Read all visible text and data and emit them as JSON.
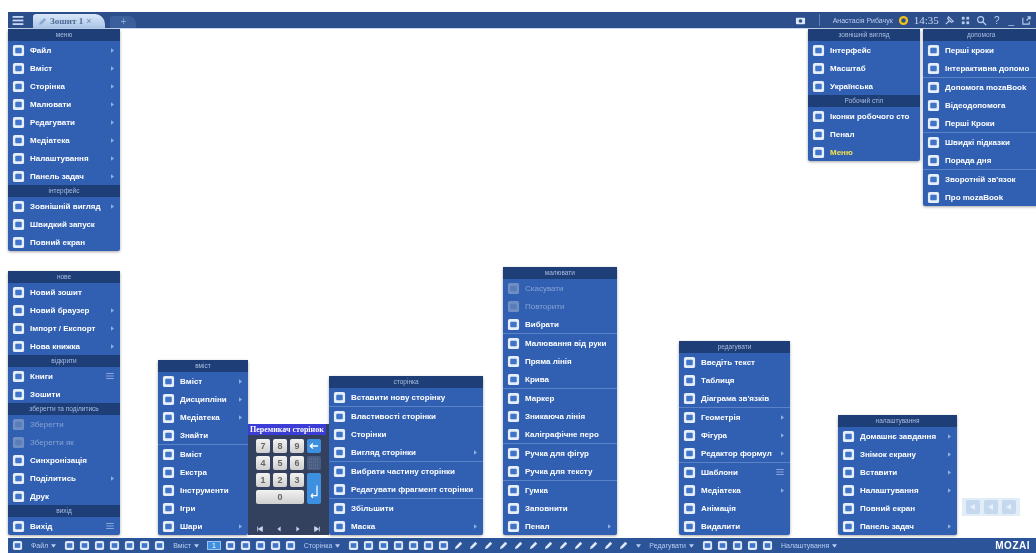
{
  "top_bar": {
    "tabs": [
      {
        "label": "Зошит 1",
        "close": "×",
        "selected": true
      }
    ],
    "add_tab": "+",
    "user": "Анастасія Рибачук",
    "time": "14:35",
    "help": "?",
    "minimize": "_"
  },
  "menus": [
    {
      "sections": [
        {
          "header": "меню",
          "groups": [
            [
              {
                "label": "Файл",
                "submenu": true
              },
              {
                "label": "Вміст",
                "submenu": true
              },
              {
                "label": "Сторінка",
                "submenu": true
              },
              {
                "label": "Малювати",
                "submenu": true
              },
              {
                "label": "Редагувати",
                "submenu": true
              },
              {
                "label": "Медіатека",
                "submenu": true
              },
              {
                "label": "Налаштування",
                "submenu": true
              },
              {
                "label": "Панель задач",
                "submenu": true
              }
            ]
          ]
        },
        {
          "header": "інтерфейс",
          "groups": [
            [
              {
                "label": "Зовнішній вигляд",
                "submenu": true
              },
              {
                "label": "Швидкий запуск",
                "submenu": false
              },
              {
                "label": "Повний екран",
                "submenu": false
              }
            ]
          ]
        }
      ]
    },
    {
      "sections": [
        {
          "header": "зовнішній вигляд",
          "groups": [
            [
              {
                "label": "Інтерфейс",
                "selected": false
              },
              {
                "label": "Масштаб",
                "selected": false
              },
              {
                "label": "Українська",
                "selected": false
              }
            ]
          ]
        },
        {
          "header": "Робочий стіл",
          "groups": [
            [
              {
                "label": "Іконки робочого сто",
                "selected": false
              },
              {
                "label": "Пенал",
                "selected": false
              },
              {
                "label": "Меню",
                "selected": true
              }
            ]
          ]
        }
      ]
    },
    {
      "sections": [
        {
          "header": "допомога",
          "groups": [
            [
              {
                "label": "Перші кроки"
              },
              {
                "label": "Інтерактивна допомо"
              }
            ],
            [
              {
                "label": "Допомога mozaBook"
              },
              {
                "label": "Відеодопомога"
              },
              {
                "label": "Перші Кроки"
              }
            ],
            [
              {
                "label": "Швидкі підказки"
              },
              {
                "label": "Порада дня"
              }
            ],
            [
              {
                "label": "Зворотній зв'язок"
              },
              {
                "label": "Про mozaBook"
              }
            ]
          ]
        }
      ]
    },
    {
      "sections": [
        {
          "header": "нове",
          "groups": [
            [
              {
                "label": "Новий зошит",
                "submenu": false,
                "list": false,
                "disabled": false
              },
              {
                "label": "Новий браузер",
                "submenu": true,
                "list": false,
                "disabled": false
              },
              {
                "label": "Імпорт / Експорт",
                "submenu": true,
                "list": false,
                "disabled": false
              },
              {
                "label": "Нова книжка",
                "submenu": true,
                "list": false,
                "disabled": false
              }
            ]
          ]
        },
        {
          "header": "відкрити",
          "groups": [
            [
              {
                "label": "Книги",
                "submenu": false,
                "list": true,
                "disabled": false
              },
              {
                "label": "Зошити",
                "submenu": false,
                "list": false,
                "disabled": false
              }
            ]
          ]
        },
        {
          "header": "зберегти та поділитись",
          "groups": [
            [
              {
                "label": "Зберегти",
                "submenu": false,
                "list": false,
                "disabled": true
              },
              {
                "label": "Зберегти як",
                "submenu": false,
                "list": false,
                "disabled": true
              },
              {
                "label": "Синхронізація",
                "submenu": false,
                "list": false,
                "disabled": false
              },
              {
                "label": "Поділитись",
                "submenu": true,
                "list": false,
                "disabled": false
              },
              {
                "label": "Друк",
                "submenu": false,
                "list": false,
                "disabled": false
              }
            ]
          ]
        },
        {
          "header": "вихід",
          "groups": [
            [
              {
                "label": "Вихід",
                "submenu": false,
                "list": true,
                "disabled": false
              }
            ]
          ]
        }
      ]
    },
    {
      "sections": [
        {
          "header": "вміст",
          "groups": [
            [
              {
                "label": "Вміст",
                "submenu": true
              },
              {
                "label": "Дисципліни",
                "submenu": true
              },
              {
                "label": "Медіатека",
                "submenu": true
              },
              {
                "label": "Знайти",
                "submenu": false
              }
            ],
            [
              {
                "label": "Вміст",
                "submenu": false
              },
              {
                "label": "Екстра",
                "submenu": false
              },
              {
                "label": "Інструменти",
                "submenu": false
              },
              {
                "label": "Ігри",
                "submenu": false
              },
              {
                "label": "Шари",
                "submenu": true
              }
            ]
          ]
        }
      ]
    },
    {
      "sections": [
        {
          "header": "сторінка",
          "groups": [
            [
              {
                "label": "Вставити нову сторінку",
                "submenu": false
              }
            ],
            [
              {
                "label": "Властивості сторінки",
                "submenu": false
              },
              {
                "label": "Сторінки",
                "submenu": false
              },
              {
                "label": "Вигляд сторінки",
                "submenu": true
              }
            ],
            [
              {
                "label": "Вибрати частину сторінки",
                "submenu": false
              },
              {
                "label": "Редагувати фрагмент сторінки",
                "submenu": false
              }
            ],
            [
              {
                "label": "Збільшити",
                "submenu": false
              },
              {
                "label": "Маска",
                "submenu": true
              }
            ]
          ]
        }
      ]
    },
    {
      "sections": [
        {
          "header": "малювати",
          "groups": [
            [
              {
                "label": "Скасувати",
                "submenu": false,
                "disabled": true
              },
              {
                "label": "Повторити",
                "submenu": false,
                "disabled": true
              },
              {
                "label": "Вибрати",
                "submenu": false,
                "disabled": false
              }
            ],
            [
              {
                "label": "Малювання від руки",
                "submenu": false,
                "disabled": false
              },
              {
                "label": "Пряма лінія",
                "submenu": false,
                "disabled": false
              },
              {
                "label": "Крива",
                "submenu": false,
                "disabled": false
              }
            ],
            [
              {
                "label": "Маркер",
                "submenu": false,
                "disabled": false
              },
              {
                "label": "Зникаюча лінія",
                "submenu": false,
                "disabled": false
              },
              {
                "label": "Каліграфічне перо",
                "submenu": false,
                "disabled": false
              }
            ],
            [
              {
                "label": "Ручка для фігур",
                "submenu": false,
                "disabled": false
              },
              {
                "label": "Ручка для тексту",
                "submenu": false,
                "disabled": false
              }
            ],
            [
              {
                "label": "Гумка",
                "submenu": false,
                "disabled": false
              },
              {
                "label": "Заповнити",
                "submenu": false,
                "disabled": false
              },
              {
                "label": "Пенал",
                "submenu": true,
                "disabled": false
              }
            ]
          ]
        }
      ]
    },
    {
      "sections": [
        {
          "header": "редагувати",
          "groups": [
            [
              {
                "label": "Введіть текст",
                "submenu": false,
                "list": false
              },
              {
                "label": "Таблиця",
                "submenu": false,
                "list": false
              },
              {
                "label": "Діаграма зв'язків",
                "submenu": false,
                "list": false
              }
            ],
            [
              {
                "label": "Геометрія",
                "submenu": true,
                "list": false
              },
              {
                "label": "Фігура",
                "submenu": true,
                "list": false
              },
              {
                "label": "Редактор формул",
                "submenu": true,
                "list": false
              }
            ],
            [
              {
                "label": "Шаблони",
                "submenu": false,
                "list": true
              },
              {
                "label": "Медіатека",
                "submenu": true,
                "list": false
              },
              {
                "label": "Анімація",
                "submenu": false,
                "list": false
              },
              {
                "label": "Видалити",
                "submenu": false,
                "list": false
              }
            ]
          ]
        }
      ]
    },
    {
      "sections": [
        {
          "header": "налаштування",
          "groups": [
            [
              {
                "label": "Домашнє завдання",
                "submenu": true
              },
              {
                "label": "Знімок екрану",
                "submenu": true
              },
              {
                "label": "Вставити",
                "submenu": true
              },
              {
                "label": "Налаштування",
                "submenu": true
              },
              {
                "label": "Повний екран",
                "submenu": false
              },
              {
                "label": "Панель задач",
                "submenu": true
              }
            ]
          ]
        }
      ]
    }
  ],
  "page_switcher": {
    "title": "Перемикач сторінок",
    "keys": [
      "7",
      "8",
      "9",
      "4",
      "5",
      "6",
      "1",
      "2",
      "3",
      "0"
    ]
  },
  "bottom_toolbar": {
    "groups": [
      {
        "label": "Файл"
      },
      {
        "label": "Вміст"
      },
      {
        "label": "Сторінка",
        "page": "1"
      },
      {
        "label": "Редагувати"
      },
      {
        "label": "Налаштування"
      }
    ],
    "logo": "MOZAI"
  }
}
